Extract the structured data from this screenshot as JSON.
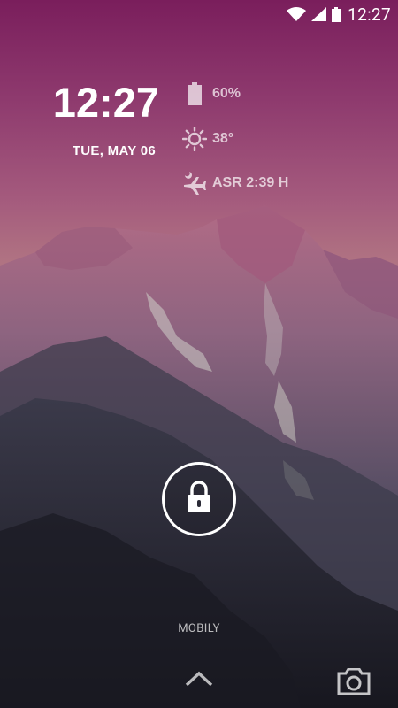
{
  "status_bar": {
    "time": "12:27",
    "icons": [
      "wifi-icon",
      "signal-icon",
      "battery-icon"
    ]
  },
  "clock": {
    "time": "12:27",
    "date": "TUE, MAY 06"
  },
  "widgets": {
    "battery": {
      "icon": "battery-icon",
      "text": "60%"
    },
    "weather": {
      "icon": "sun-icon",
      "text": "38°"
    },
    "prayer": {
      "icon": "airplane-moon-icon",
      "text": "ASR 2:39 H"
    }
  },
  "lock": {
    "icon": "padlock-icon"
  },
  "carrier": "MOBILY",
  "bottom": {
    "left_icon": "chevron-up-icon",
    "right_icon": "camera-icon"
  },
  "colors": {
    "sky_top": "#7a1e5c",
    "sky_mid": "#b07382",
    "mountain_shadow": "#1e1f2b",
    "text": "#ffffff"
  }
}
